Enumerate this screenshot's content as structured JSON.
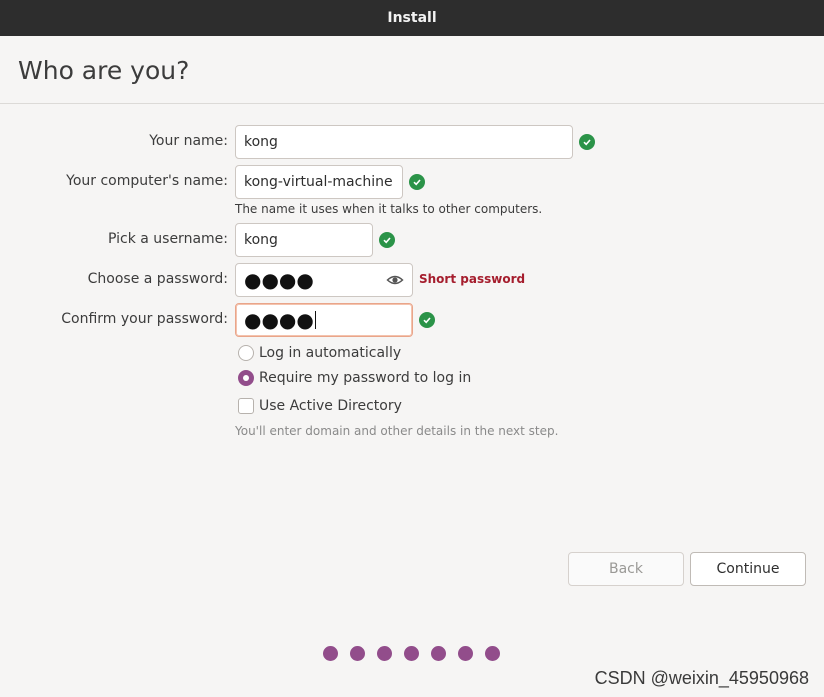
{
  "window": {
    "title": "Install"
  },
  "page": {
    "title": "Who are you?"
  },
  "form": {
    "name": {
      "label": "Your name:",
      "value": "kong",
      "valid": true
    },
    "computer_name": {
      "label": "Your computer's name:",
      "value": "kong-virtual-machine",
      "hint": "The name it uses when it talks to other computers.",
      "valid": true
    },
    "username": {
      "label": "Pick a username:",
      "value": "kong",
      "valid": true
    },
    "password": {
      "label": "Choose a password:",
      "masked_value": "●●●●",
      "strength": "Short password"
    },
    "confirm_password": {
      "label": "Confirm your password:",
      "masked_value": "●●●●",
      "valid": true
    }
  },
  "login_options": {
    "auto_login": {
      "label": "Log in automatically",
      "selected": false
    },
    "require_password": {
      "label": "Require my password to log in",
      "selected": true
    }
  },
  "active_directory": {
    "label": "Use Active Directory",
    "checked": false,
    "hint": "You'll enter domain and other details in the next step."
  },
  "buttons": {
    "back": "Back",
    "continue": "Continue"
  },
  "progress": {
    "steps": 7
  },
  "watermark": "CSDN @weixin_45950968",
  "colors": {
    "accent": "#924d8b",
    "valid": "#2b9348",
    "warning": "#a51d2d",
    "titlebar": "#2d2d2d"
  },
  "icons": {
    "valid": "check-circle-icon",
    "reveal_password": "eye-icon"
  }
}
